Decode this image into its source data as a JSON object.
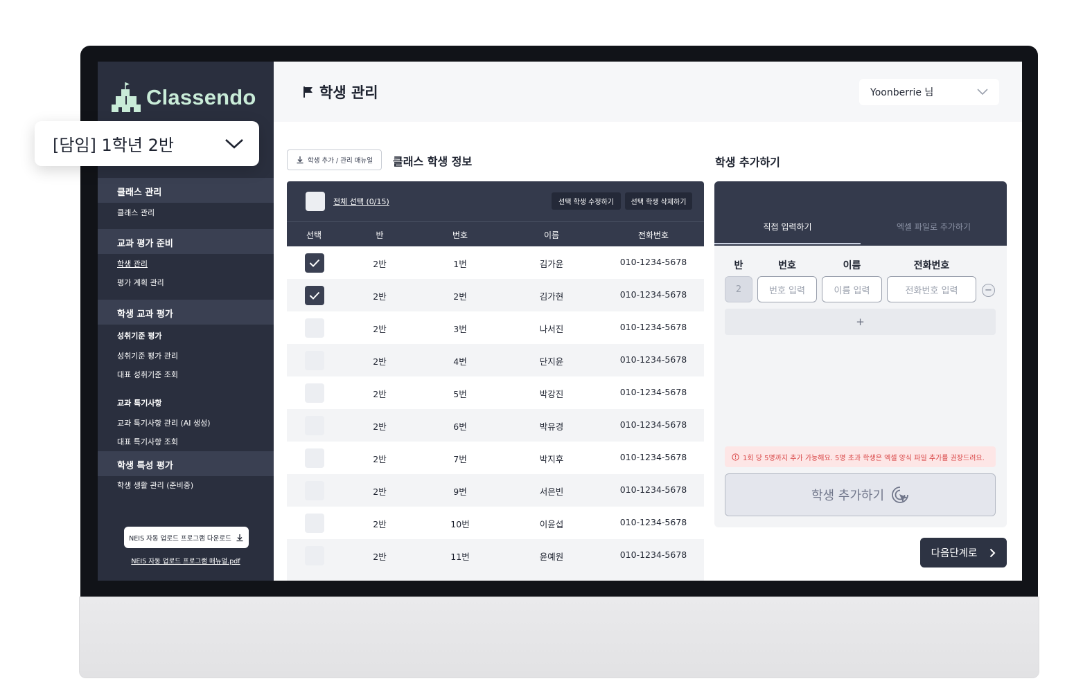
{
  "app": {
    "name": "Classendo"
  },
  "class_selector": {
    "value": "[담임] 1학년 2반"
  },
  "sidebar": {
    "sections": [
      {
        "title": "클래스 관리",
        "items": [
          "클래스 관리"
        ]
      },
      {
        "title": "교과 평가 준비",
        "items": [
          "학생 관리",
          "평가 계획 관리"
        ]
      },
      {
        "title": "학생 교과 평가",
        "groups": [
          {
            "title": "성취기준 평가",
            "items": [
              "성취기준 평가 관리",
              "대표 성취기준 조회"
            ]
          },
          {
            "title": "교과 특기사항",
            "items": [
              "교과 특기사항 관리 (AI 생성)",
              "대표 특기사항 조회"
            ]
          }
        ]
      },
      {
        "title": "학생 특성 평가",
        "items": [
          "학생 생활 관리 (준비중)"
        ]
      }
    ],
    "active_item": "학생 관리",
    "neis_download_label": "NEIS 자동 업로드 프로그램 다운로드",
    "neis_manual_link": "NEIS 자동 업로드 프로그램 매뉴얼.pdf"
  },
  "header": {
    "title": "학생 관리",
    "user": "Yoonberrie 님"
  },
  "students_panel": {
    "manual_button": "학생 추가 / 관리 매뉴얼",
    "title": "클래스 학생 정보",
    "select_all": "전체 선택 (0/15)",
    "edit_button": "선택 학생 수정하기",
    "delete_button": "선택 학생 삭제하기",
    "columns": [
      "선택",
      "반",
      "번호",
      "이름",
      "전화번호"
    ],
    "rows": [
      {
        "checked": true,
        "ban": "2반",
        "number": "1번",
        "name": "김가윤",
        "phone": "010-1234-5678"
      },
      {
        "checked": true,
        "ban": "2반",
        "number": "2번",
        "name": "김가현",
        "phone": "010-1234-5678"
      },
      {
        "checked": false,
        "ban": "2반",
        "number": "3번",
        "name": "나서진",
        "phone": "010-1234-5678"
      },
      {
        "checked": false,
        "ban": "2반",
        "number": "4번",
        "name": "단지윤",
        "phone": "010-1234-5678"
      },
      {
        "checked": false,
        "ban": "2반",
        "number": "5번",
        "name": "박강진",
        "phone": "010-1234-5678"
      },
      {
        "checked": false,
        "ban": "2반",
        "number": "6번",
        "name": "박유경",
        "phone": "010-1234-5678"
      },
      {
        "checked": false,
        "ban": "2반",
        "number": "7번",
        "name": "박지후",
        "phone": "010-1234-5678"
      },
      {
        "checked": false,
        "ban": "2반",
        "number": "9번",
        "name": "서은빈",
        "phone": "010-1234-5678"
      },
      {
        "checked": false,
        "ban": "2반",
        "number": "10번",
        "name": "이윤섭",
        "phone": "010-1234-5678"
      },
      {
        "checked": false,
        "ban": "2반",
        "number": "11번",
        "name": "윤예원",
        "phone": "010-1234-5678"
      }
    ]
  },
  "add_panel": {
    "title": "학생 추가하기",
    "tabs": [
      "직접 입력하기",
      "엑셀 파일로 추가하기"
    ],
    "active_tab": "직접 입력하기",
    "labels": {
      "ban": "반",
      "number": "번호",
      "name": "이름",
      "phone": "전화번호"
    },
    "ban_value": "2",
    "placeholders": {
      "number": "번호 입력",
      "name": "이름 입력",
      "phone": "전화번호 입력"
    },
    "add_row_symbol": "+",
    "warning": "1회 당 5명까지 추가 가능해요. 5명 초과 학생은 엑셀 양식 파일 추가를 권장드려요.",
    "submit_button": "학생 추가하기"
  },
  "next_button": "다음단계로",
  "colors": {
    "sidebar": "#2a2f3e",
    "accent_dark": "#343a4c",
    "logo": "#c9ecd8",
    "warning": "#d94646"
  }
}
